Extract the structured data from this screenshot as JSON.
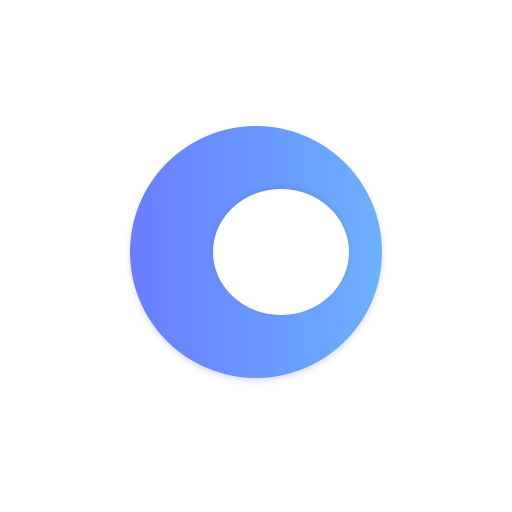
{
  "logo": {
    "icon": "ring-logo-icon",
    "gradient_start": "#6a7dff",
    "gradient_end": "#6cb0ff",
    "hole_color": "#ffffff",
    "background": "#ffffff"
  }
}
